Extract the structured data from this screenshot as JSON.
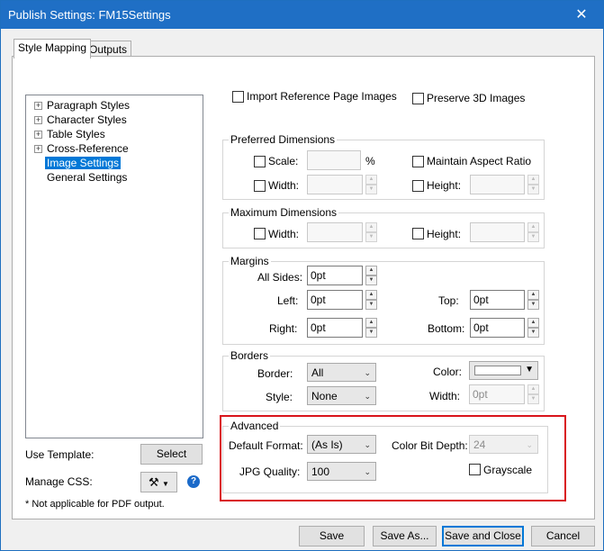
{
  "window": {
    "title": "Publish Settings: FM15Settings",
    "close_glyph": "✕"
  },
  "tabs": [
    "Style Mapping",
    "Outputs"
  ],
  "tree": {
    "items": [
      "Paragraph Styles",
      "Character Styles",
      "Table Styles",
      "Cross-Reference",
      "Image Settings",
      "General Settings"
    ],
    "selected": "Image Settings"
  },
  "top_options": {
    "import_ref_images": "Import Reference Page Images",
    "preserve_3d": "Preserve 3D Images"
  },
  "preferred": {
    "legend": "Preferred Dimensions",
    "scale": "Scale:",
    "percent": "%",
    "maintain": "Maintain Aspect Ratio",
    "width": "Width:",
    "height": "Height:"
  },
  "maximum": {
    "legend": "Maximum Dimensions",
    "width": "Width:",
    "height": "Height:"
  },
  "margins": {
    "legend": "Margins",
    "all_sides": "All Sides:",
    "all_sides_value": "0pt",
    "left": "Left:",
    "left_value": "0pt",
    "top": "Top:",
    "top_value": "0pt",
    "right": "Right:",
    "right_value": "0pt",
    "bottom": "Bottom:",
    "bottom_value": "0pt"
  },
  "borders": {
    "legend": "Borders",
    "border": "Border:",
    "border_value": "All",
    "color": "Color:",
    "style": "Style:",
    "style_value": "None",
    "width": "Width:",
    "width_value": "0pt"
  },
  "advanced": {
    "legend": "Advanced",
    "default_format": "Default Format:",
    "default_format_value": "(As Is)",
    "color_bit_depth": "Color Bit Depth:",
    "color_bit_depth_value": "24",
    "jpg_quality": "JPG Quality:",
    "jpg_quality_value": "100",
    "grayscale": "Grayscale"
  },
  "left_footer": {
    "use_template": "Use Template:",
    "select": "Select",
    "manage_css": "Manage CSS:",
    "note": "* Not applicable for PDF output."
  },
  "buttons": {
    "save": "Save",
    "save_as": "Save As...",
    "save_close": "Save and Close",
    "cancel": "Cancel"
  },
  "icons": {
    "tools": "wrench-screwdriver-icon",
    "help": "help-icon",
    "dropdown": "chevron-down-icon"
  },
  "colors": {
    "titlebar": "#1f6fc5",
    "selection": "#0078d7",
    "highlight_box": "#d9141b"
  }
}
